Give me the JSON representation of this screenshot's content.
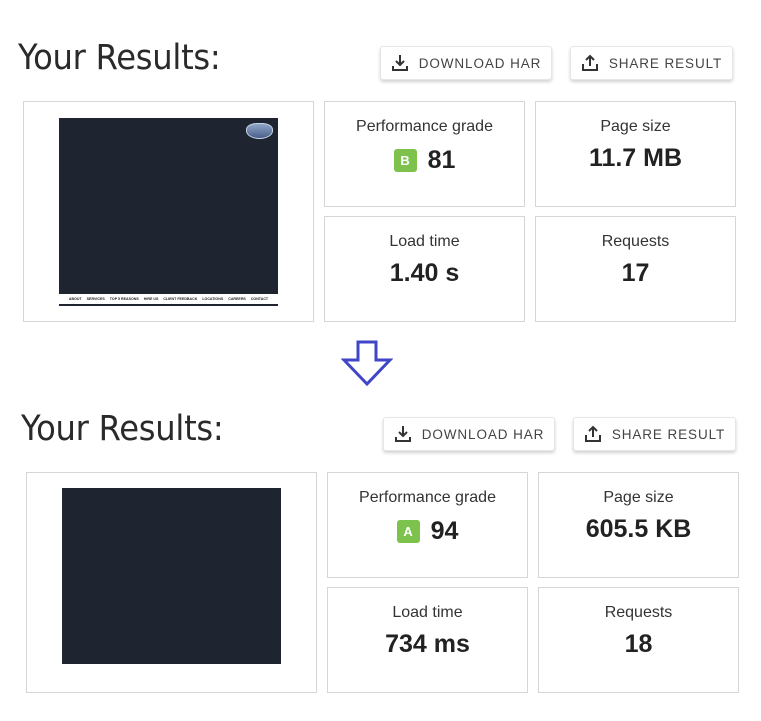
{
  "before": {
    "title": "Your Results:",
    "buttons": {
      "download_har": "DOWNLOAD HAR",
      "share_result": "SHARE RESULT"
    },
    "screenshot": {
      "nav_items": [
        "ABOUT",
        "SERVICES",
        "TOP 5 REASONS",
        "HIRE US",
        "CLIENT FEEDBACK",
        "LOCATIONS",
        "CAREERS",
        "CONTACT"
      ]
    },
    "metrics": {
      "performance": {
        "label": "Performance grade",
        "grade": "B",
        "score": "81"
      },
      "page_size": {
        "label": "Page size",
        "value": "11.7 MB"
      },
      "load_time": {
        "label": "Load time",
        "value": "1.40 s"
      },
      "requests": {
        "label": "Requests",
        "value": "17"
      }
    }
  },
  "after": {
    "title": "Your Results:",
    "buttons": {
      "download_har": "DOWNLOAD HAR",
      "share_result": "SHARE RESULT"
    },
    "metrics": {
      "performance": {
        "label": "Performance grade",
        "grade": "A",
        "score": "94"
      },
      "page_size": {
        "label": "Page size",
        "value": "605.5 KB"
      },
      "load_time": {
        "label": "Load time",
        "value": "734 ms"
      },
      "requests": {
        "label": "Requests",
        "value": "18"
      }
    }
  },
  "colors": {
    "grade_badge": "#7cc24d",
    "arrow": "#4046c8",
    "screenshot_bg": "#1f2431"
  },
  "icons": {
    "download": "download-icon",
    "share": "share-icon",
    "arrow": "arrow-down-icon"
  }
}
